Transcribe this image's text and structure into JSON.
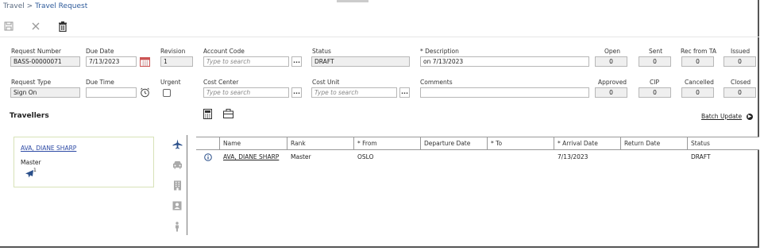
{
  "breadcrumb": {
    "root": "Travel",
    "separator": ">",
    "current": "Travel Request"
  },
  "header": {
    "request_number": {
      "label": "Request Number",
      "value": "BASS-00000071"
    },
    "due_date": {
      "label": "Due Date",
      "value": "7/13/2023"
    },
    "revision": {
      "label": "Revision",
      "value": "1"
    },
    "account_code": {
      "label": "Account Code",
      "placeholder": "Type to search"
    },
    "status": {
      "label": "Status",
      "value": "DRAFT"
    },
    "description": {
      "label": "* Description",
      "value": "on 7/13/2023"
    },
    "open": {
      "label": "Open",
      "value": "0"
    },
    "sent": {
      "label": "Sent",
      "value": "0"
    },
    "rec_from_ta": {
      "label": "Rec from TA",
      "value": "0"
    },
    "issued": {
      "label": "Issued",
      "value": "0"
    },
    "request_type": {
      "label": "Request Type",
      "value": "Sign On"
    },
    "due_time": {
      "label": "Due Time",
      "value": ""
    },
    "urgent": {
      "label": "Urgent",
      "checked": false
    },
    "cost_center": {
      "label": "Cost Center",
      "placeholder": "Type to search"
    },
    "cost_unit": {
      "label": "Cost Unit",
      "placeholder": "Type to search"
    },
    "comments": {
      "label": "Comments",
      "value": ""
    },
    "approved": {
      "label": "Approved",
      "value": "0"
    },
    "cip": {
      "label": "CIP",
      "value": "0"
    },
    "cancelled": {
      "label": "Cancelled",
      "value": "0"
    },
    "closed": {
      "label": "Closed",
      "value": "0"
    },
    "ellipsis": "..."
  },
  "travellers": {
    "title": "Travellers",
    "batch_update": "Batch Update",
    "card": {
      "name": "AVA, DIANE SHARP",
      "rank": "Master",
      "flight_count": "1"
    }
  },
  "grid": {
    "columns": [
      "",
      "Name",
      "Rank",
      "* From",
      "Departure Date",
      "* To",
      "* Arrival Date",
      "Return Date",
      "Status"
    ],
    "rows": [
      {
        "name": "AVA, DIANE SHARP",
        "rank": "Master",
        "from": "OSLO",
        "departure": "",
        "to": "",
        "arrival": "7/13/2023",
        "return": "",
        "status": "DRAFT"
      }
    ]
  },
  "colors": {
    "link": "#2d4aa5",
    "accent": "#2d5a9a",
    "card_border": "#d7e2b8",
    "flight_icon": "#2a4f8a"
  }
}
